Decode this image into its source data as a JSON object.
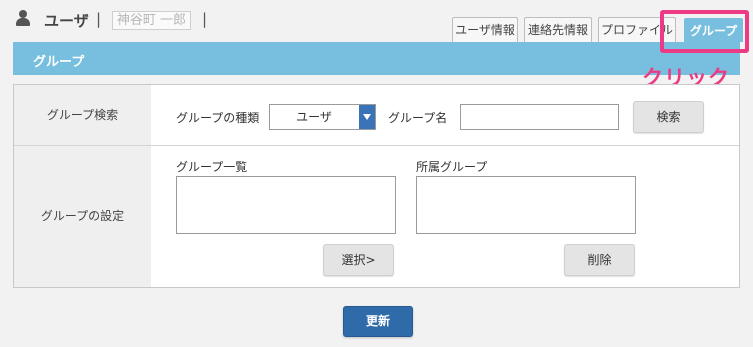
{
  "header": {
    "user_label": "ユーザ",
    "separator": "|",
    "user_name": "神谷町 一郎"
  },
  "tabs": [
    {
      "label": "ユーザ情報",
      "active": false
    },
    {
      "label": "連絡先情報",
      "active": false
    },
    {
      "label": "プロファイル",
      "active": false
    },
    {
      "label": "グループ",
      "active": true
    }
  ],
  "annotation": {
    "click_label": "クリック",
    "color": "#ec3b84"
  },
  "section": {
    "title": "グループ"
  },
  "search_row": {
    "label": "グループ検索",
    "type_label": "グループの種類",
    "type_value": "ユーザ",
    "name_label": "グループ名",
    "name_value": "",
    "search_button": "検索"
  },
  "settings_row": {
    "label": "グループの設定",
    "list_label": "グループ一覧",
    "member_label": "所属グループ",
    "select_button": "選択>",
    "delete_button": "削除"
  },
  "update_button": "更新",
  "colors": {
    "accent": "#78bfdf",
    "primary_button": "#2f6aa9",
    "select_arrow": "#3b73b8"
  }
}
